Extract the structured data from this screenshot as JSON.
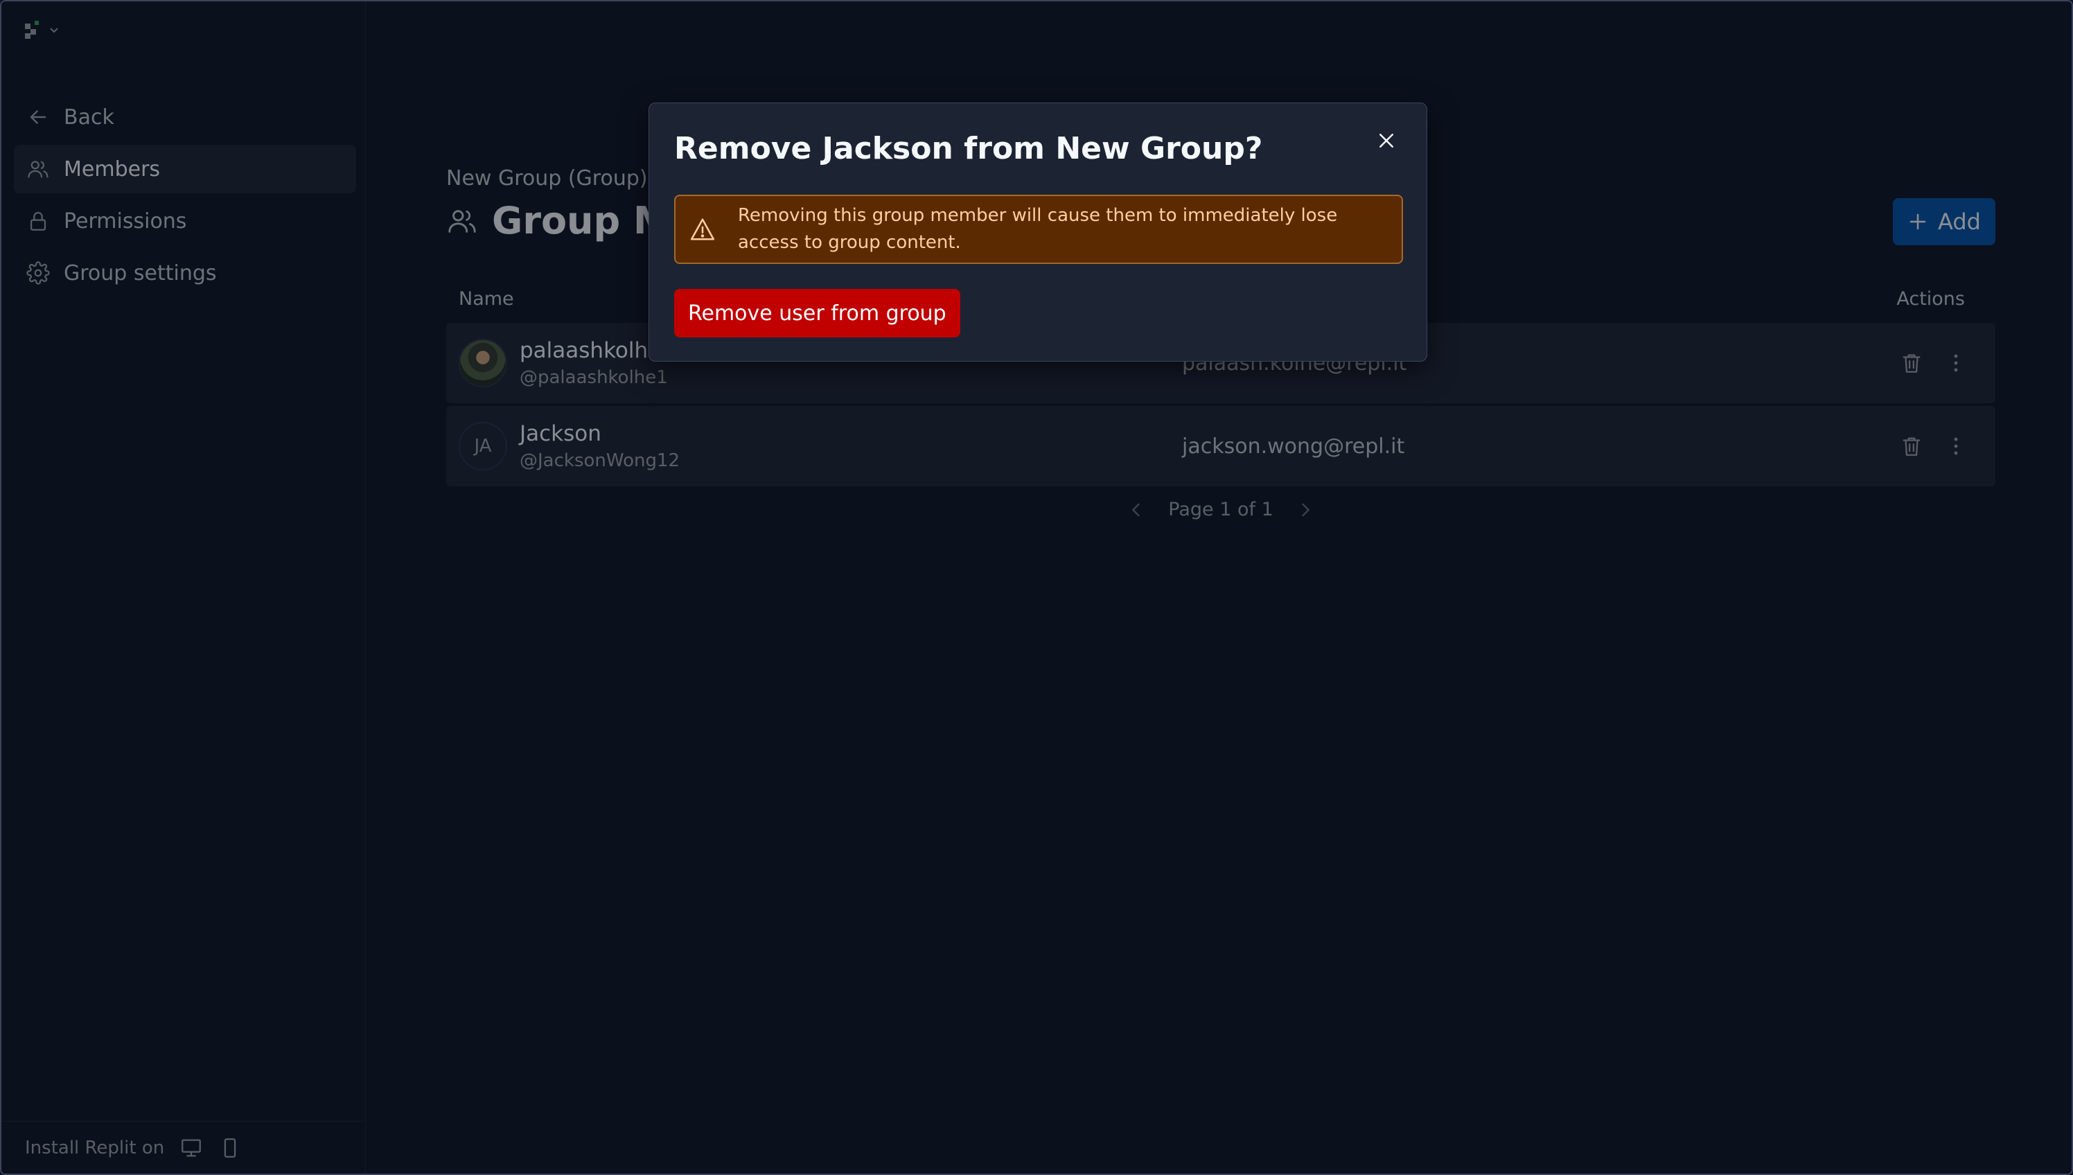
{
  "sidebar": {
    "nav": [
      {
        "label": "Back",
        "icon": "arrow-left-icon"
      },
      {
        "label": "Members",
        "icon": "users-icon",
        "active": true
      },
      {
        "label": "Permissions",
        "icon": "lock-icon"
      },
      {
        "label": "Group settings",
        "icon": "gear-icon"
      }
    ],
    "install_label": "Install Replit on"
  },
  "main": {
    "group_subtitle": "New Group (Group)",
    "page_title": "Group Members",
    "add_label": "Add",
    "table": {
      "columns": {
        "name": "Name",
        "actions": "Actions"
      },
      "rows": [
        {
          "name": "palaashkolhe",
          "handle": "@palaashkolhe1",
          "email": "palaash.kolhe@repl.it",
          "avatar": "photo"
        },
        {
          "name": "Jackson",
          "handle": "@JacksonWong12",
          "email": "jackson.wong@repl.it",
          "avatar": "JA"
        }
      ]
    },
    "pager": {
      "label": "Page 1 of 1"
    }
  },
  "modal": {
    "title": "Remove Jackson from New Group?",
    "warning": "Removing this group member will cause them to immediately lose access to group content.",
    "confirm_label": "Remove user from group"
  },
  "colors": {
    "background": "#0e1525",
    "surface": "#1c2333",
    "accent": "#0053a6",
    "danger": "#c10000",
    "warning_bg": "#5c2a00",
    "warning_text": "#ffcf9e"
  }
}
